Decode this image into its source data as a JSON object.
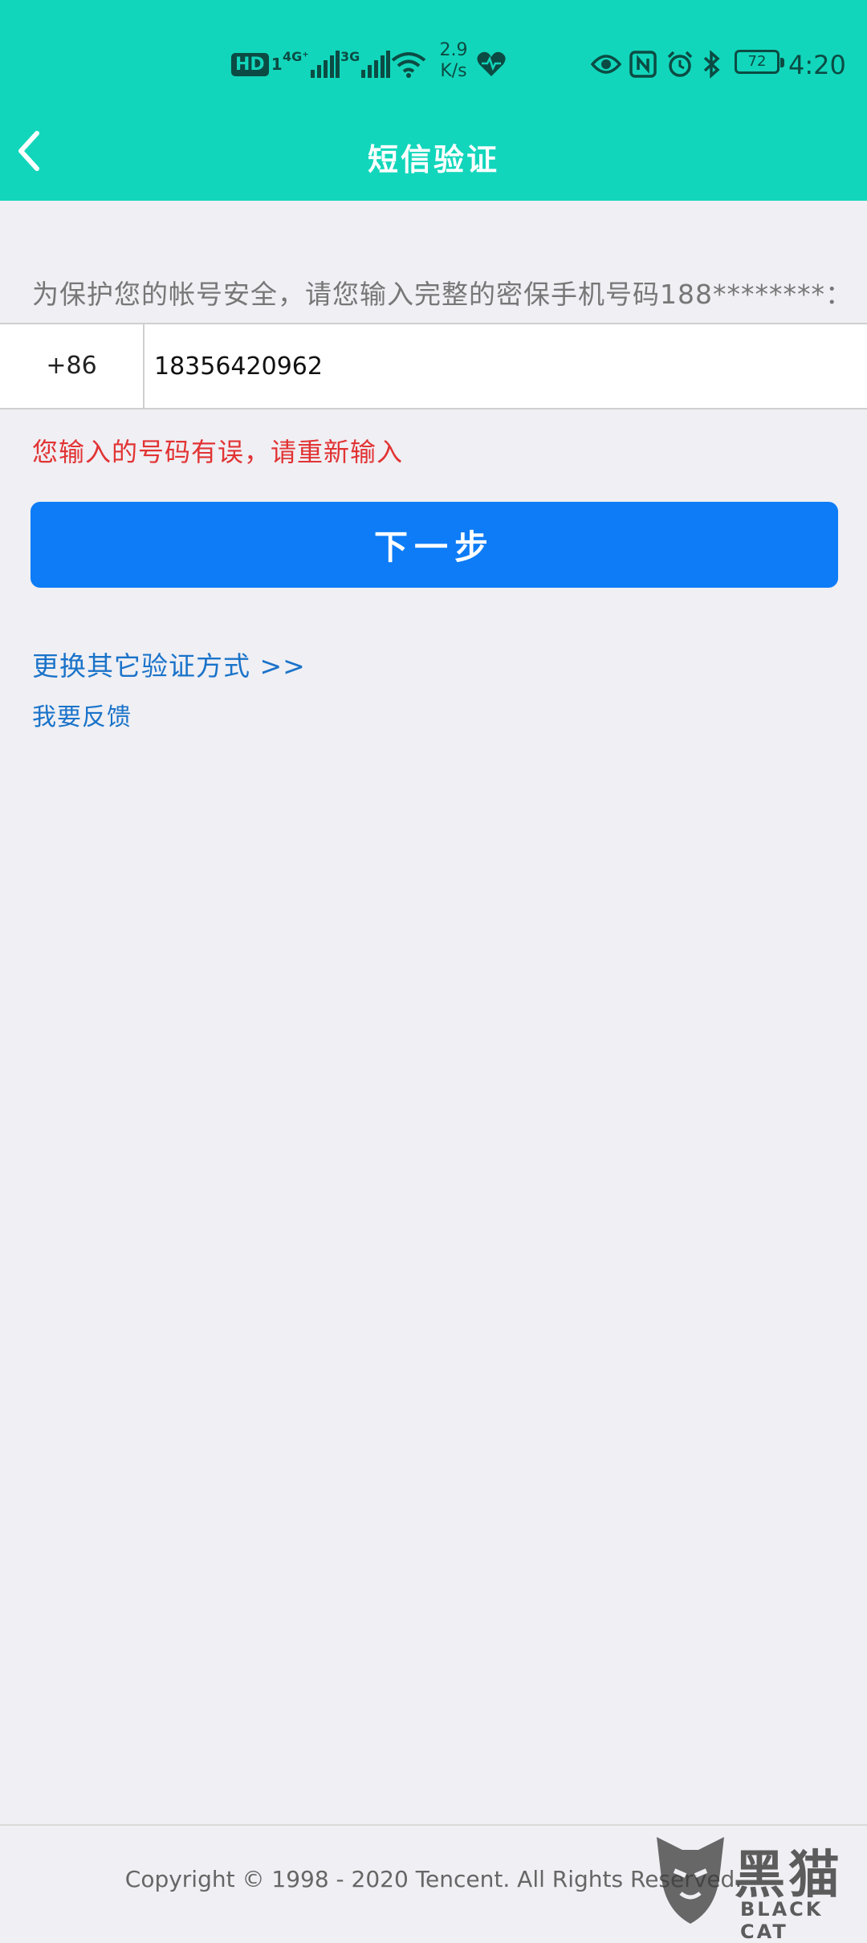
{
  "status_bar": {
    "hd_label": "HD",
    "sim_indicator": "1",
    "network_1": "4G⁺",
    "network_2": "3G",
    "speed_value": "2.9",
    "speed_unit": "K/s",
    "battery_level": "72",
    "time": "4:20",
    "icon_color": "#0b4b43"
  },
  "header": {
    "title": "短信验证",
    "background_color": "#12d6bb"
  },
  "form": {
    "instruction": "为保护您的帐号安全，请您输入完整的密保手机号码188********：",
    "country_code": "+86",
    "phone_value": "18356420962",
    "error_message": "您输入的号码有误，请重新输入",
    "next_button_label": "下一步",
    "button_color": "#0d7cf6",
    "error_color": "#e23333"
  },
  "links": {
    "other_method": "更换其它验证方式 >>",
    "feedback": "我要反馈",
    "link_color": "#1a73c9"
  },
  "footer": {
    "copyright": "Copyright © 1998 - 2020 Tencent. All Rights Reserved."
  },
  "watermark": {
    "cn_text": "黑猫",
    "en_text": "BLACK CAT"
  }
}
